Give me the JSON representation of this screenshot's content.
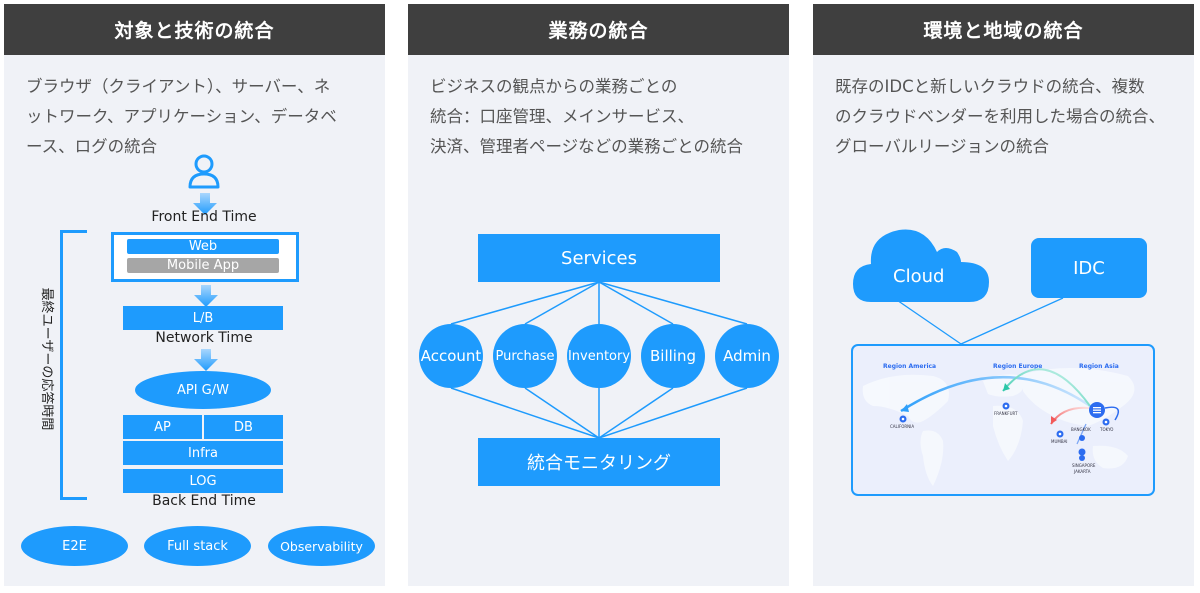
{
  "colors": {
    "accent": "#1e9bfd",
    "header_bg": "#3f3f3f",
    "panel_bg": "#f0f2f7",
    "muted": "#a6a6a6"
  },
  "panels": [
    {
      "title": "対象と技術の統合",
      "description": "ブラウザ（クライアント）、サーバー、ネ\nットワーク、アプリケーション、データベ\nース、ログの統合",
      "user_icon": "user-icon",
      "front_end_label": "Front End Time",
      "web_label": "Web",
      "mobile_label": "Mobile App",
      "lb_label": "L/B",
      "network_label": "Network Time",
      "api_label": "API G/W",
      "ap_label": "AP",
      "db_label": "DB",
      "infra_label": "Infra",
      "log_label": "LOG",
      "back_end_label": "Back End Time",
      "bracket_label": "最終ユーザーの応答時間",
      "tags": [
        "E2E",
        "Full stack",
        "Observability"
      ]
    },
    {
      "title": "業務の統合",
      "description": "ビジネスの観点からの業務ごとの\n統合：口座管理、メインサービス、\n決済、管理者ページなどの業務ごとの統合",
      "top_label": "Services",
      "nodes": [
        "Account",
        "Purchase",
        "Inventory",
        "Billing",
        "Admin"
      ],
      "bottom_label": "統合モニタリング"
    },
    {
      "title": "環境と地域の統合",
      "description": "既存のIDCと新しいクラウドの統合、複数\nのクラウドベンダーを利用した場合の統合、\nグローバルリージョンの統合",
      "cloud_label": "Cloud",
      "idc_label": "IDC",
      "regions": [
        "Region America",
        "Region Europe",
        "Region Asia"
      ],
      "cities": [
        "CALIFORNIA",
        "FRANKFURT",
        "MUMBAI",
        "BANGKOK",
        "TOKYO",
        "SINGAPORE",
        "JAKARTA"
      ]
    }
  ]
}
